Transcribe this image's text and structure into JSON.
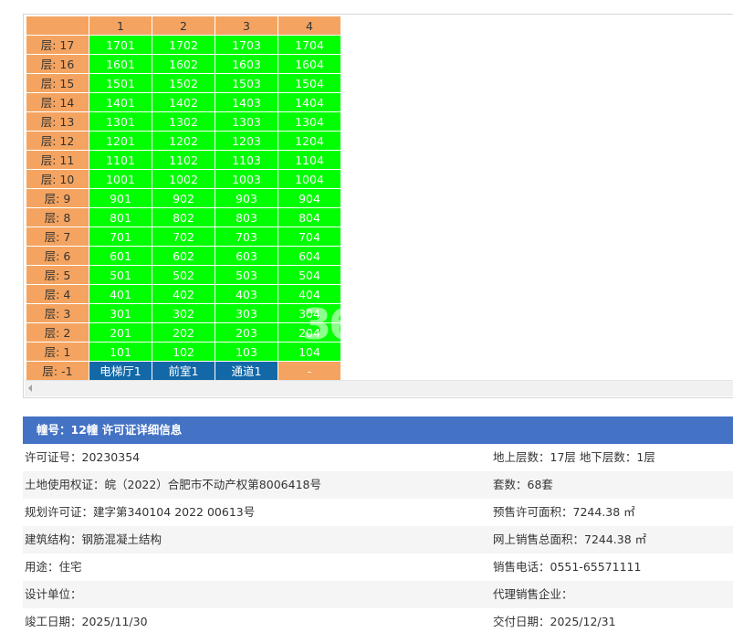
{
  "building_table": {
    "columns": [
      "",
      "1",
      "2",
      "3",
      "4"
    ],
    "rows": [
      {
        "floor": "层: 17",
        "units": [
          "1701",
          "1702",
          "1703",
          "1704"
        ]
      },
      {
        "floor": "层: 16",
        "units": [
          "1601",
          "1602",
          "1603",
          "1604"
        ]
      },
      {
        "floor": "层: 15",
        "units": [
          "1501",
          "1502",
          "1503",
          "1504"
        ]
      },
      {
        "floor": "层: 14",
        "units": [
          "1401",
          "1402",
          "1403",
          "1404"
        ]
      },
      {
        "floor": "层: 13",
        "units": [
          "1301",
          "1302",
          "1303",
          "1304"
        ]
      },
      {
        "floor": "层: 12",
        "units": [
          "1201",
          "1202",
          "1203",
          "1204"
        ]
      },
      {
        "floor": "层: 11",
        "units": [
          "1101",
          "1102",
          "1103",
          "1104"
        ]
      },
      {
        "floor": "层: 10",
        "units": [
          "1001",
          "1002",
          "1003",
          "1004"
        ]
      },
      {
        "floor": "层: 9",
        "units": [
          "901",
          "902",
          "903",
          "904"
        ]
      },
      {
        "floor": "层: 8",
        "units": [
          "801",
          "802",
          "803",
          "804"
        ]
      },
      {
        "floor": "层: 7",
        "units": [
          "701",
          "702",
          "703",
          "704"
        ]
      },
      {
        "floor": "层: 6",
        "units": [
          "601",
          "602",
          "603",
          "604"
        ]
      },
      {
        "floor": "层: 5",
        "units": [
          "501",
          "502",
          "503",
          "504"
        ]
      },
      {
        "floor": "层: 4",
        "units": [
          "401",
          "402",
          "403",
          "404"
        ]
      },
      {
        "floor": "层: 3",
        "units": [
          "301",
          "302",
          "303",
          "304"
        ]
      },
      {
        "floor": "层: 2",
        "units": [
          "201",
          "202",
          "203",
          "204"
        ]
      },
      {
        "floor": "层: 1",
        "units": [
          "101",
          "102",
          "103",
          "104"
        ]
      }
    ],
    "basement": {
      "floor": "层: -1",
      "cells": [
        {
          "text": "电梯厅1",
          "style": "blue"
        },
        {
          "text": "前室1",
          "style": "blue"
        },
        {
          "text": "通道1",
          "style": "blue"
        },
        {
          "text": "-",
          "style": "dash"
        }
      ]
    },
    "colors": {
      "header": "#f4a460",
      "available": "#00ff00",
      "facility": "#1369a8"
    }
  },
  "watermark_text": "365",
  "permit": {
    "title": "幢号：12幢 许可证详细信息",
    "rows": [
      {
        "left": "许可证号：20230354",
        "right": "地上层数：17层  地下层数：1层"
      },
      {
        "left": "土地使用权证：皖（2022）合肥市不动产权第8006418号",
        "right": "套数：68套"
      },
      {
        "left": "规划许可证：建字第340104 2022 00613号",
        "right": "预售许可面积：7244.38 ㎡"
      },
      {
        "left": "建筑结构：钢筋混凝土结构",
        "right": "网上销售总面积：7244.38 ㎡"
      },
      {
        "left": "用途：住宅",
        "right": "销售电话：0551-65571111"
      },
      {
        "left": "设计单位：",
        "right": "代理销售企业："
      },
      {
        "left": "竣工日期：2025/11/30",
        "right": "交付日期：2025/12/31"
      }
    ]
  }
}
